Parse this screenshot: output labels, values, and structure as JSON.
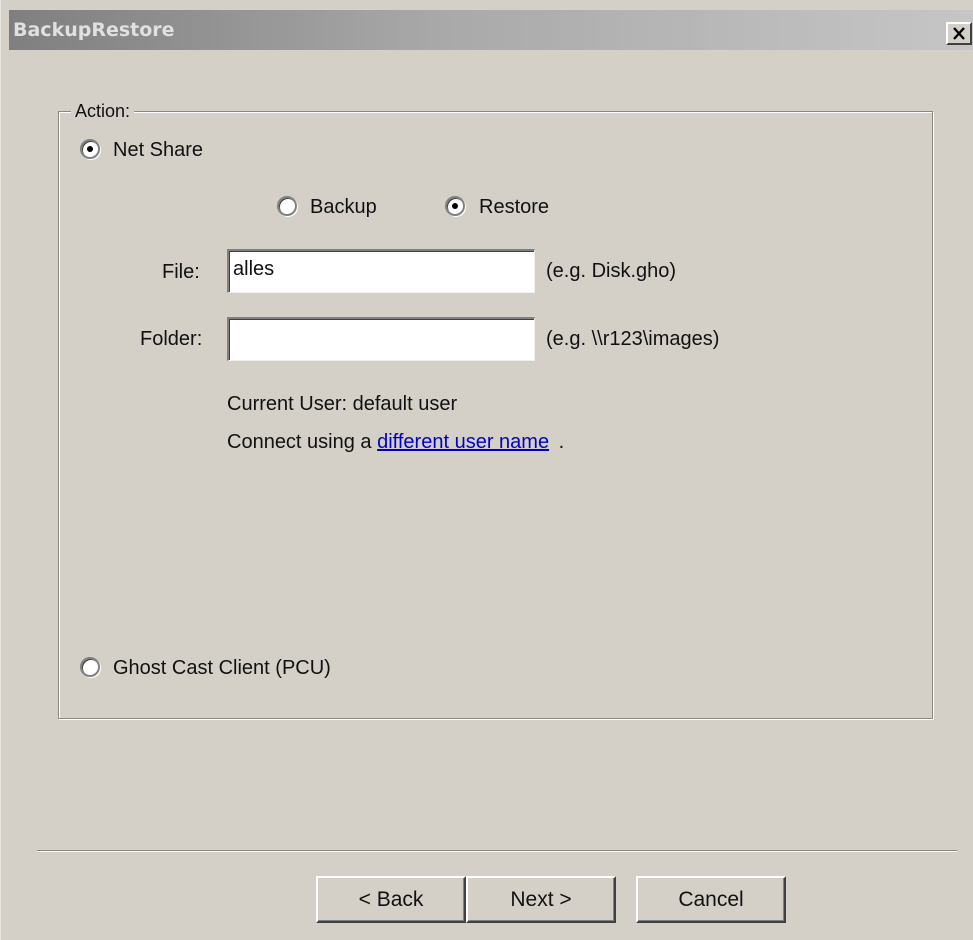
{
  "window": {
    "title": "BackupRestore"
  },
  "action_group": {
    "legend": "Action:",
    "net_share": {
      "label": "Net Share",
      "selected": true
    },
    "mode": {
      "backup": {
        "label": "Backup",
        "selected": false
      },
      "restore": {
        "label": "Restore",
        "selected": true
      }
    },
    "file": {
      "label": "File:",
      "value": "alles",
      "hint": "(e.g. Disk.gho)"
    },
    "folder": {
      "label": "Folder:",
      "value": "",
      "hint": "(e.g. \\\\r123\\images)"
    },
    "current_user": "Current User: default user",
    "connect_prefix": "Connect using a",
    "connect_link": "different user name",
    "connect_suffix": ".",
    "ghost_cast": {
      "label": "Ghost Cast Client (PCU)",
      "selected": false
    }
  },
  "buttons": {
    "back": "< Back",
    "next": "Next >",
    "cancel": "Cancel"
  },
  "colors": {
    "dialog_bg": "#d4d0c8",
    "link": "#0000cc",
    "title_gradient_start": "#7f7f7f"
  },
  "icons": {
    "close": "close-icon"
  }
}
